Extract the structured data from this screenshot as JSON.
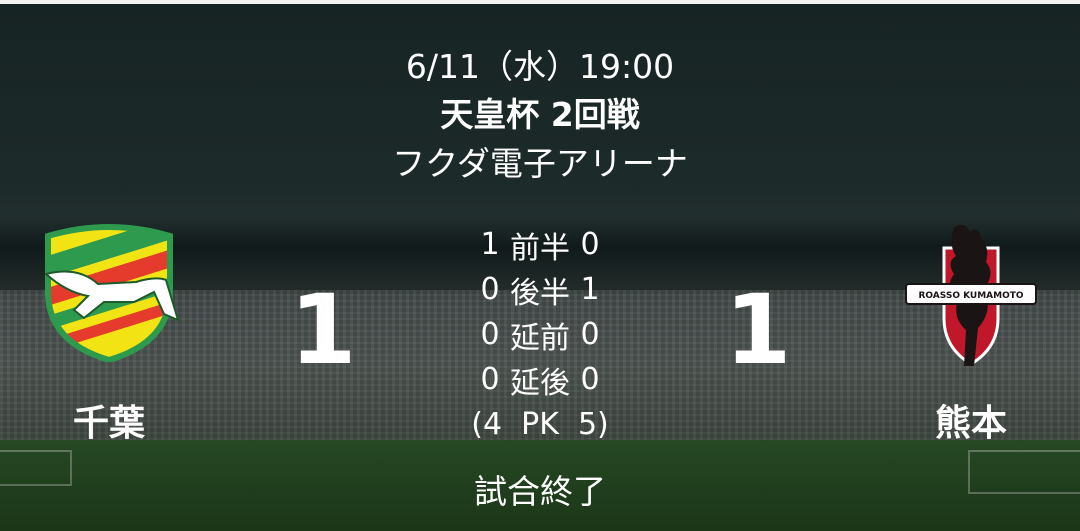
{
  "match": {
    "date": "6/11（水）19:00",
    "competition": "天皇杯 2回戦",
    "venue": "フクダ電子アリーナ",
    "status": "試合終了"
  },
  "home": {
    "name": "千葉",
    "score": "1",
    "emblem": "jef-chiba-emblem"
  },
  "away": {
    "name": "熊本",
    "score": "1",
    "emblem": "roasso-kumamoto-emblem",
    "emblem_text": "ROASSO KUMAMOTO"
  },
  "periods": [
    {
      "home": "1",
      "label": "前半",
      "away": "0"
    },
    {
      "home": "0",
      "label": "後半",
      "away": "1"
    },
    {
      "home": "0",
      "label": "延前",
      "away": "0"
    },
    {
      "home": "0",
      "label": "延後",
      "away": "0"
    }
  ],
  "pk": "(4  PK  5)",
  "colors": {
    "home_green": "#2e9a4e",
    "home_yellow": "#f2e315",
    "away_red": "#c0182a",
    "away_black": "#1a1414"
  }
}
